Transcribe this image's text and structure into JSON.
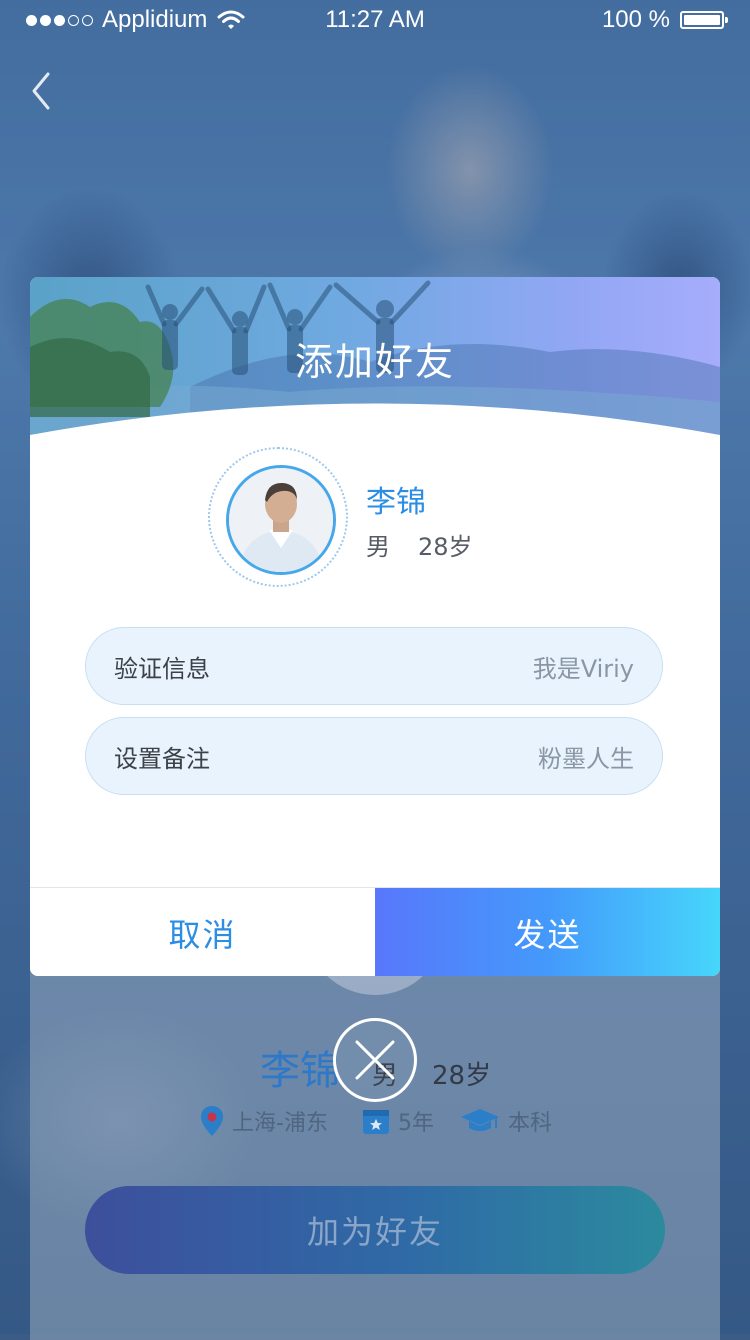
{
  "status_bar": {
    "carrier": "Applidium",
    "time": "11:27 AM",
    "battery": "100 %",
    "icons": [
      "signal-dots-icon",
      "wifi-icon",
      "battery-icon"
    ]
  },
  "nav": {
    "back_icon": "chevron-left-icon"
  },
  "background_profile": {
    "name": "李锦",
    "gender": "男",
    "age": "28岁",
    "location": "上海-浦东",
    "years": "5年",
    "education": "本科",
    "add_friend_label": "加为好友",
    "icons": [
      "location-pin-icon",
      "calendar-icon",
      "graduation-cap-icon"
    ]
  },
  "modal": {
    "title": "添加好友",
    "profile": {
      "name": "李锦",
      "gender": "男",
      "age": "28岁"
    },
    "fields": [
      {
        "label": "验证信息",
        "value": "我是Viriy"
      },
      {
        "label": "设置备注",
        "value": "粉墨人生"
      }
    ],
    "cancel_label": "取消",
    "send_label": "发送",
    "close_icon": "close-icon"
  },
  "colors": {
    "accent_blue": "#2b8de4",
    "send_gradient_start": "#5877fb",
    "send_gradient_end": "#46d6fb",
    "field_bg": "#e8f3fd"
  }
}
